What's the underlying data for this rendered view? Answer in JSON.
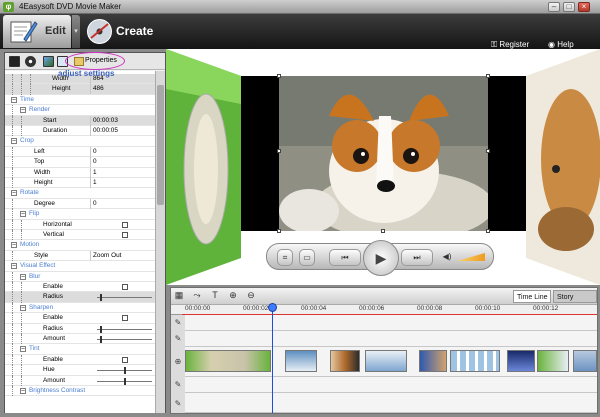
{
  "window": {
    "title": "4Easysoft DVD Movie Maker",
    "logo": "φ"
  },
  "toolbar": {
    "edit_label": "Edit",
    "create_label": "Create",
    "register_label": "Register",
    "help_label": "Help"
  },
  "left_panel": {
    "properties_label": "Properties",
    "annotation": "adjust settings",
    "rows": [
      {
        "label": "Width",
        "value": "864",
        "indent": 3,
        "shade": true
      },
      {
        "label": "Height",
        "value": "486",
        "indent": 3,
        "shade": true
      },
      {
        "label": "Time",
        "section": true,
        "indent": 0
      },
      {
        "label": "Render",
        "section": true,
        "indent": 1
      },
      {
        "label": "Start",
        "value": "00:00:03",
        "indent": 2,
        "shade": true
      },
      {
        "label": "Duration",
        "value": "00:00:05",
        "indent": 2
      },
      {
        "label": "Crop",
        "section": true,
        "indent": 0
      },
      {
        "label": "Left",
        "value": "0",
        "indent": 1
      },
      {
        "label": "Top",
        "value": "0",
        "indent": 1
      },
      {
        "label": "Width",
        "value": "1",
        "indent": 1
      },
      {
        "label": "Height",
        "value": "1",
        "indent": 1
      },
      {
        "label": "Rotate",
        "section": true,
        "indent": 0
      },
      {
        "label": "Degree",
        "value": "0",
        "indent": 1
      },
      {
        "label": "Flip",
        "section": true,
        "indent": 1
      },
      {
        "label": "Horizontal",
        "checkbox": true,
        "indent": 2
      },
      {
        "label": "Vertical",
        "checkbox": true,
        "indent": 2
      },
      {
        "label": "Motion",
        "section": true,
        "indent": 0
      },
      {
        "label": "Style",
        "value": "Zoom Out",
        "indent": 1
      },
      {
        "label": "Visual Effect",
        "section": true,
        "indent": 0
      },
      {
        "label": "Blur",
        "section": true,
        "indent": 1
      },
      {
        "label": "Enable",
        "checkbox": true,
        "indent": 2
      },
      {
        "label": "Radius",
        "slider": 0.05,
        "indent": 2,
        "shade": true
      },
      {
        "label": "Sharpen",
        "section": true,
        "indent": 1
      },
      {
        "label": "Enable",
        "checkbox": true,
        "indent": 2
      },
      {
        "label": "Radius",
        "slider": 0.05,
        "indent": 2
      },
      {
        "label": "Amount",
        "slider": 0.05,
        "indent": 2
      },
      {
        "label": "Tint",
        "section": true,
        "indent": 1
      },
      {
        "label": "Enable",
        "checkbox": true,
        "indent": 2
      },
      {
        "label": "Hue",
        "slider": 0.5,
        "indent": 2
      },
      {
        "label": "Amount",
        "slider": 0.5,
        "indent": 2
      },
      {
        "label": "Brightness Contrast",
        "section": true,
        "indent": 1
      }
    ]
  },
  "timeline": {
    "time_line_tab": "Time Line",
    "story_board_tab": "Story Board",
    "ticks": [
      "00:00:00",
      "00:00:02",
      "00:00:04",
      "00:00:06",
      "00:00:08",
      "00:00:10",
      "00:00:12"
    ]
  },
  "colors": {
    "accent": "#4a7ed1",
    "timeline_red": "#d33333",
    "playhead": "#1a4fd6",
    "annotation_ellipse": "#d037c2"
  }
}
